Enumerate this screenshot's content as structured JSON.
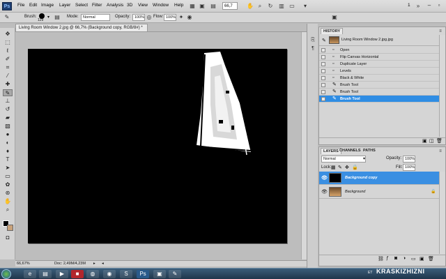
{
  "app": {
    "logo": "Ps"
  },
  "menu": [
    "File",
    "Edit",
    "Image",
    "Layer",
    "Select",
    "Filter",
    "Analysis",
    "3D",
    "View",
    "Window",
    "Help"
  ],
  "menubar": {
    "zoom": "66,7",
    "workspace_count": "1"
  },
  "options": {
    "brush_label": "Brush:",
    "brush_size": "129",
    "mode_label": "Mode:",
    "mode_value": "Normal",
    "opacity_label": "Opacity:",
    "opacity_value": "100%",
    "flow_label": "Flow:",
    "flow_value": "100%"
  },
  "document": {
    "tab_title": "Living Room Window 2.jpg @ 66,7% (Background copy, RGB/8#) *",
    "zoom_status": "66,67%",
    "doc_info": "Doc: 2,49M/4,23M"
  },
  "history": {
    "tab": "HISTORY",
    "snapshot": "Living Room Window 2.jpg.jpg",
    "items": [
      {
        "label": "Open",
        "icon": "doc-icon"
      },
      {
        "label": "Flip Canvas Horizontal",
        "icon": "doc-icon"
      },
      {
        "label": "Duplicate Layer",
        "icon": "doc-icon"
      },
      {
        "label": "Levels",
        "icon": "doc-icon"
      },
      {
        "label": "Black & White",
        "icon": "doc-icon"
      },
      {
        "label": "Brush Tool",
        "icon": "brush-icon"
      },
      {
        "label": "Brush Tool",
        "icon": "brush-icon"
      },
      {
        "label": "Brush Tool",
        "icon": "brush-icon"
      }
    ]
  },
  "layers": {
    "tabs": [
      "LAYERS",
      "CHANNELS",
      "PATHS"
    ],
    "blend_mode": "Normal",
    "opacity_label": "Opacity:",
    "opacity_value": "100%",
    "lock_label": "Lock:",
    "fill_label": "Fill:",
    "fill_value": "100%",
    "items": [
      {
        "name": "Background copy"
      },
      {
        "name": "Background"
      }
    ]
  },
  "taskbar": {
    "language": "ET",
    "watermark": "KRASKIZHIZNI"
  },
  "colors": {
    "selection": "#2f8de4",
    "background_swatch": "#c9a27a"
  }
}
